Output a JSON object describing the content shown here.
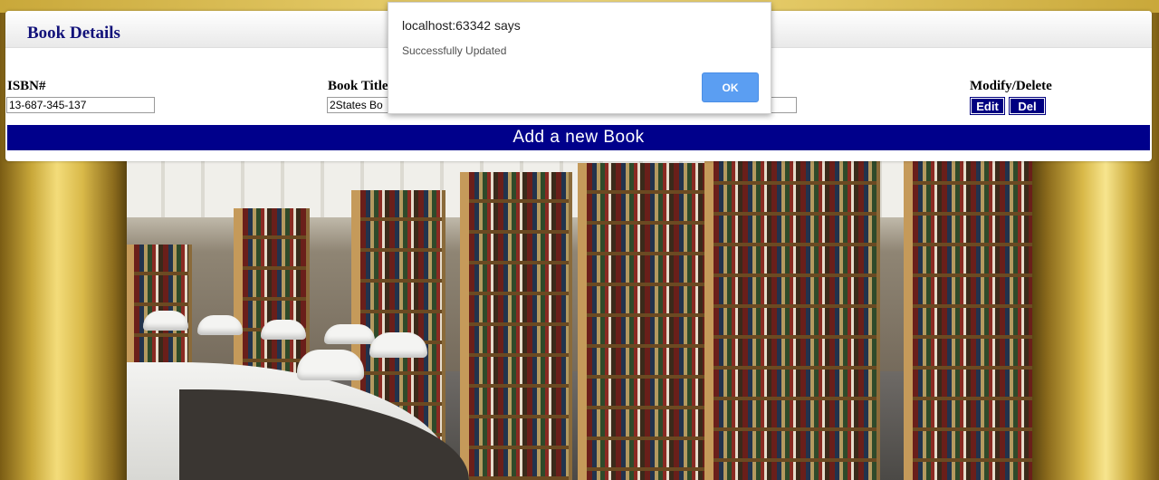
{
  "dialog": {
    "title": "localhost:63342 says",
    "message": "Successfully Updated",
    "ok_label": "OK"
  },
  "panel": {
    "title": "Book Details"
  },
  "columns": {
    "isbn_label": "ISBN#",
    "title_label": "Book Title",
    "modify_label": "Modify/Delete"
  },
  "row": {
    "isbn": "13-687-345-137",
    "title": "2States Bo",
    "third_field": ""
  },
  "buttons": {
    "edit": "Edit",
    "delete": "Del",
    "add_new": "Add a new Book"
  },
  "colors": {
    "navy": "#000080",
    "title_blue": "#13137a",
    "ok_blue": "#5b9ef2"
  }
}
